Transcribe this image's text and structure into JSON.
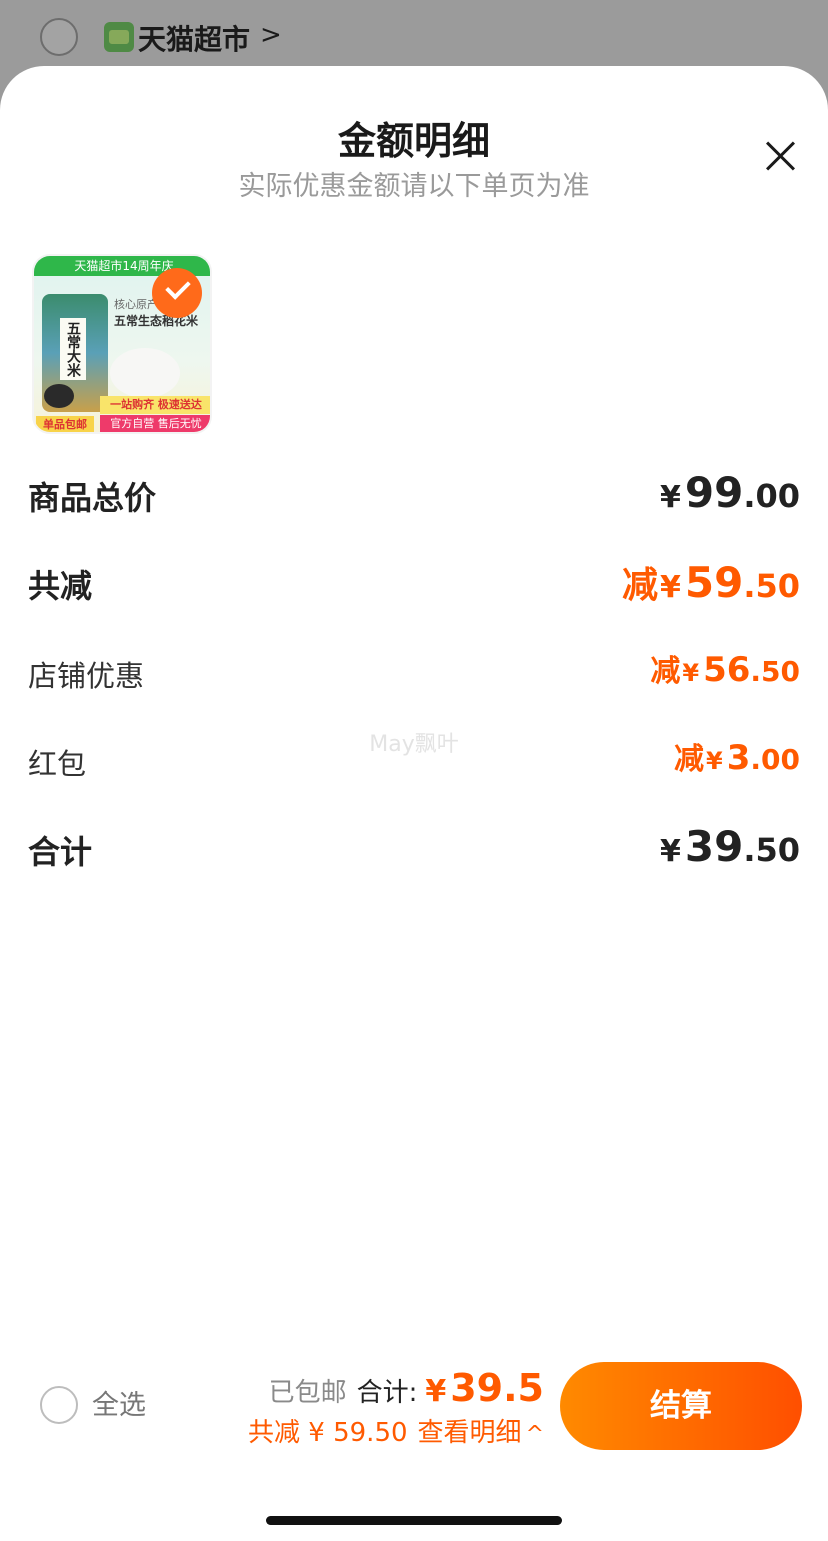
{
  "store": {
    "name": "天猫超市",
    "logo_text": "超市",
    "chevron": ">"
  },
  "sheet": {
    "title": "金额明细",
    "subtitle": "实际优惠金额请以下单页为准"
  },
  "product": {
    "banner": "天猫超市14周年庆",
    "bag_text": "五常大米",
    "mid_text": "核心原产地",
    "mid_title": "五常生态稻花米",
    "ad_line1": "一站购齐 极速送达",
    "ad_line2": "官方自营 售后无忧",
    "ship_tag": "单品包邮",
    "selected": true
  },
  "rows": {
    "subtotal": {
      "label": "商品总价",
      "yen": "¥",
      "int": "99",
      "dec": ".00"
    },
    "discount_total": {
      "label": "共减",
      "prefix": "减",
      "yen": "¥",
      "int": "59",
      "dec": ".50"
    },
    "store_discount": {
      "label": "店铺优惠",
      "prefix": "减",
      "yen": "¥",
      "int": "56",
      "dec": ".50"
    },
    "red_packet": {
      "label": "红包",
      "prefix": "减",
      "yen": "¥",
      "int": "3",
      "dec": ".00"
    },
    "total": {
      "label": "合计",
      "yen": "¥",
      "int": "39",
      "dec": ".50"
    }
  },
  "watermark": "May飘叶",
  "bottom": {
    "select_all": "全选",
    "shipped": "已包邮",
    "total_label": "合计:",
    "total_yen": "¥",
    "total_value": "39.5",
    "discount_text": "共减 ¥ 59.50",
    "details_link": "查看明细",
    "details_chevron": "^",
    "checkout": "结算"
  },
  "colors": {
    "accent": "#ff5a00",
    "button_start": "#ff8a00",
    "button_end": "#ff4f00"
  }
}
